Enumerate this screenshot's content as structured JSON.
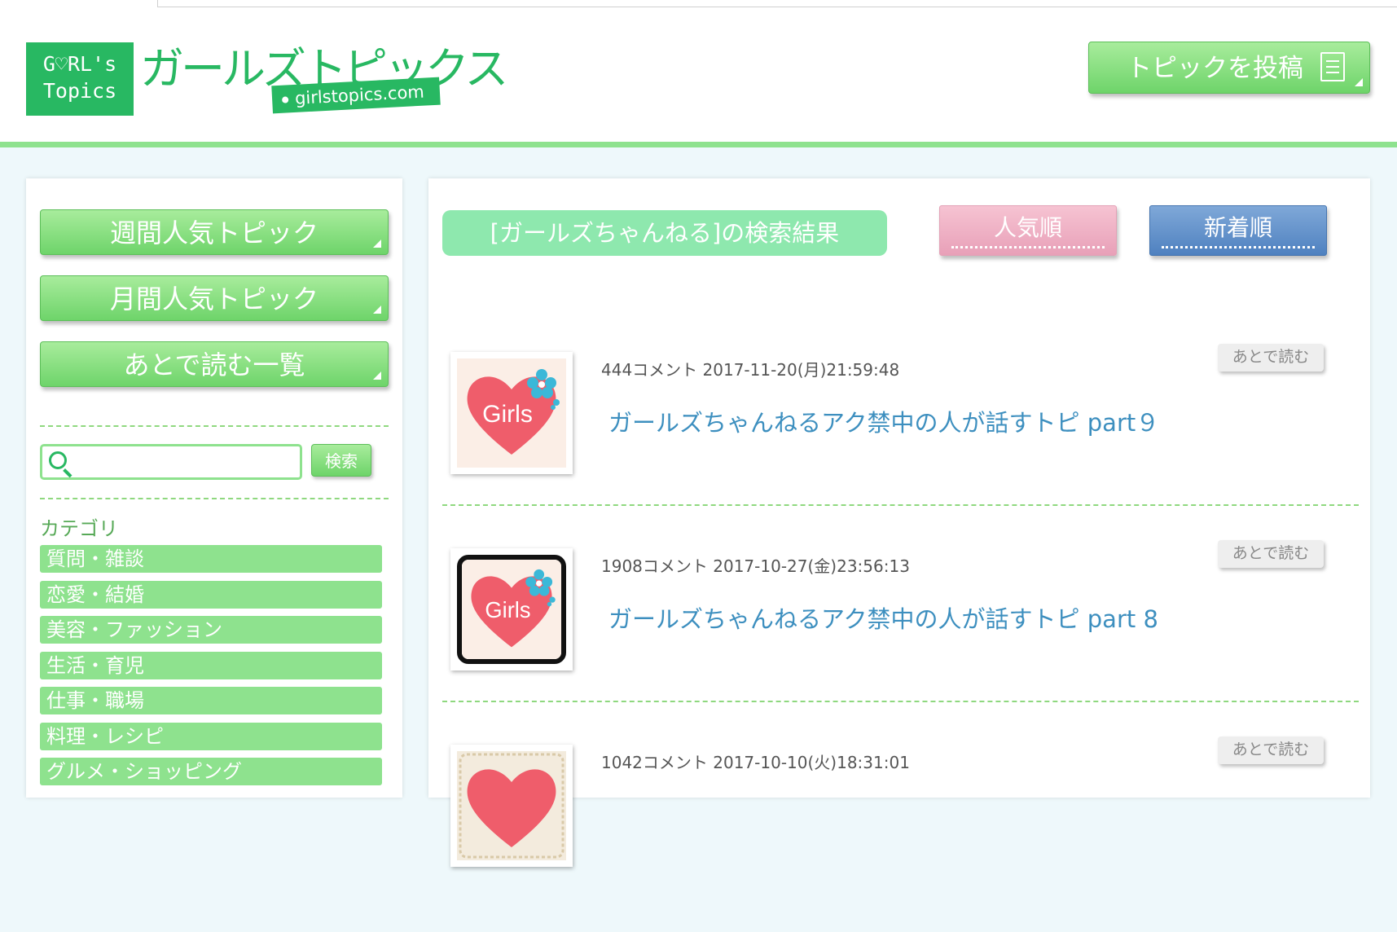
{
  "header": {
    "logo_line1": "G♡RL's",
    "logo_line2": "Topics",
    "logo_kana": "ガールズトピックス",
    "logo_url": "girlstopics.com",
    "post_button": "トピックを投稿"
  },
  "sidebar": {
    "buttons": [
      "週間人気トピック",
      "月間人気トピック",
      "あとで読む一覧"
    ],
    "search": {
      "placeholder": "",
      "value": "",
      "button": "検索"
    },
    "category_title": "カテゴリ",
    "categories": [
      "質問・雑談",
      "恋愛・結婚",
      "美容・ファッション",
      "生活・育児",
      "仕事・職場",
      "料理・レシピ",
      "グルメ・ショッピング"
    ]
  },
  "main": {
    "result_title": "[ガールズちゃんねる]の検索結果",
    "sort_popular": "人気順",
    "sort_new": "新着順",
    "read_later_label": "あとで読む",
    "items": [
      {
        "meta": "444コメント 2017-11-20(月)21:59:48",
        "title": "ガールズちゃんねるアク禁中の人が話すトピ part９",
        "thumb_text": "Girls"
      },
      {
        "meta": "1908コメント 2017-10-27(金)23:56:13",
        "title": "ガールズちゃんねるアク禁中の人が話すトピ part 8",
        "thumb_text": "Girls"
      },
      {
        "meta": "1042コメント 2017-10-10(火)18:31:01",
        "title": "",
        "thumb_text": ""
      }
    ]
  },
  "colors": {
    "brand_green": "#28b862",
    "light_green": "#8ee28e",
    "title_blue": "#3d8fbf",
    "pink": "#e8a0b8",
    "blue": "#4f81c0",
    "heart": "#ef5d6b",
    "flower": "#3bb8d8"
  },
  "icons": [
    "memo-icon",
    "search-icon",
    "heart-logo-icon",
    "flower-icon"
  ]
}
